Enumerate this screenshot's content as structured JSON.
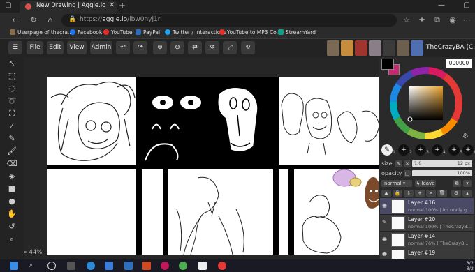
{
  "browser": {
    "tab_title": "New Drawing | Aggie.io",
    "url_host": "aggie.io",
    "url_path": "/lbw0nyj1rj",
    "url_scheme": "https://",
    "bookmarks": [
      {
        "label": "Userpage of thecra...",
        "color": "#8b6a4a"
      },
      {
        "label": "Facebook",
        "color": "#1877f2"
      },
      {
        "label": "YouTube",
        "color": "#e52d27"
      },
      {
        "label": "PayPal",
        "color": "#2a6ebb"
      },
      {
        "label": "Twitter / Interactions",
        "color": "#1da1f2"
      },
      {
        "label": "YouTube to MP3 Co...",
        "color": "#e52d27"
      },
      {
        "label": "StreamYard",
        "color": "#16a085"
      }
    ]
  },
  "toolbar": {
    "menu_icon": "hamburger-icon",
    "file": "File",
    "edit": "Edit",
    "view": "View",
    "admin": "Admin",
    "user_name": "TheCrazyBA (C..."
  },
  "canvas": {
    "zoom": "44%"
  },
  "colors": {
    "primary": "#000000",
    "secondary": "#c42b6e",
    "hex": "000000"
  },
  "brush": {
    "sizes": [
      "1",
      "2",
      "3",
      "4",
      "5",
      "6"
    ],
    "size_label": "size",
    "size_value": "1.0",
    "size_max": "12 px",
    "opacity_label": "opacity",
    "opacity_value": "100%",
    "blend_mode": "normal",
    "leave_label": "leave"
  },
  "layers": [
    {
      "name": "Layer #16",
      "meta": "normal 100% | im really g..."
    },
    {
      "name": "Layer #20",
      "meta": "normal 100% | TheCrazyB..."
    },
    {
      "name": "Layer #14",
      "meta": "normal 76% | TheCrazyB..."
    },
    {
      "name": "Layer #19",
      "meta": ""
    }
  ],
  "taskbar": {
    "time": "8/2",
    "date": "8/2"
  }
}
